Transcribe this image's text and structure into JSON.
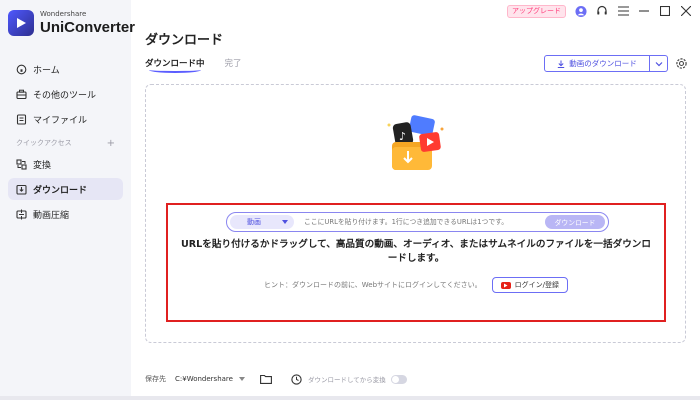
{
  "brand": {
    "sub": "Wondershare",
    "main": "UniConverter"
  },
  "sidebar": {
    "items": [
      {
        "label": "ホーム",
        "icon": "home-icon"
      },
      {
        "label": "その他のツール",
        "icon": "toolbox-icon"
      },
      {
        "label": "マイファイル",
        "icon": "file-icon"
      }
    ],
    "section_label": "クイックアクセス",
    "section_plus": "+",
    "quick_items": [
      {
        "label": "変換",
        "icon": "convert-icon"
      },
      {
        "label": "ダウンロード",
        "icon": "download-icon",
        "active": true
      },
      {
        "label": "動画圧縮",
        "icon": "compress-icon"
      }
    ]
  },
  "topbar": {
    "upgrade": "アップグレード"
  },
  "main": {
    "title": "ダウンロード",
    "tabs": [
      {
        "label": "ダウンロード中",
        "active": true
      },
      {
        "label": "完了",
        "active": false
      }
    ],
    "download_button": "動画のダウンロード",
    "url_bar": {
      "type": "動画",
      "placeholder": "ここにURLを貼り付けます。1行につき追加できるURLは1つです。",
      "button": "ダウンロード"
    },
    "message": "URLを貼り付けるかドラッグして、高品質の動画、オーディオ、またはサムネイルのファイルを一括ダウンロードします。",
    "hint": "ヒント：ダウンロードの前に、Webサイトにログインしてください。",
    "login": "ログイン/登録"
  },
  "bottom": {
    "save_label": "保存先",
    "path": "C:¥Wondershare",
    "convert_label": "ダウンロードしてから変換"
  },
  "colors": {
    "accent": "#5b5dff",
    "highlight_box": "#e02020",
    "upgrade": "#ff3d7b"
  }
}
